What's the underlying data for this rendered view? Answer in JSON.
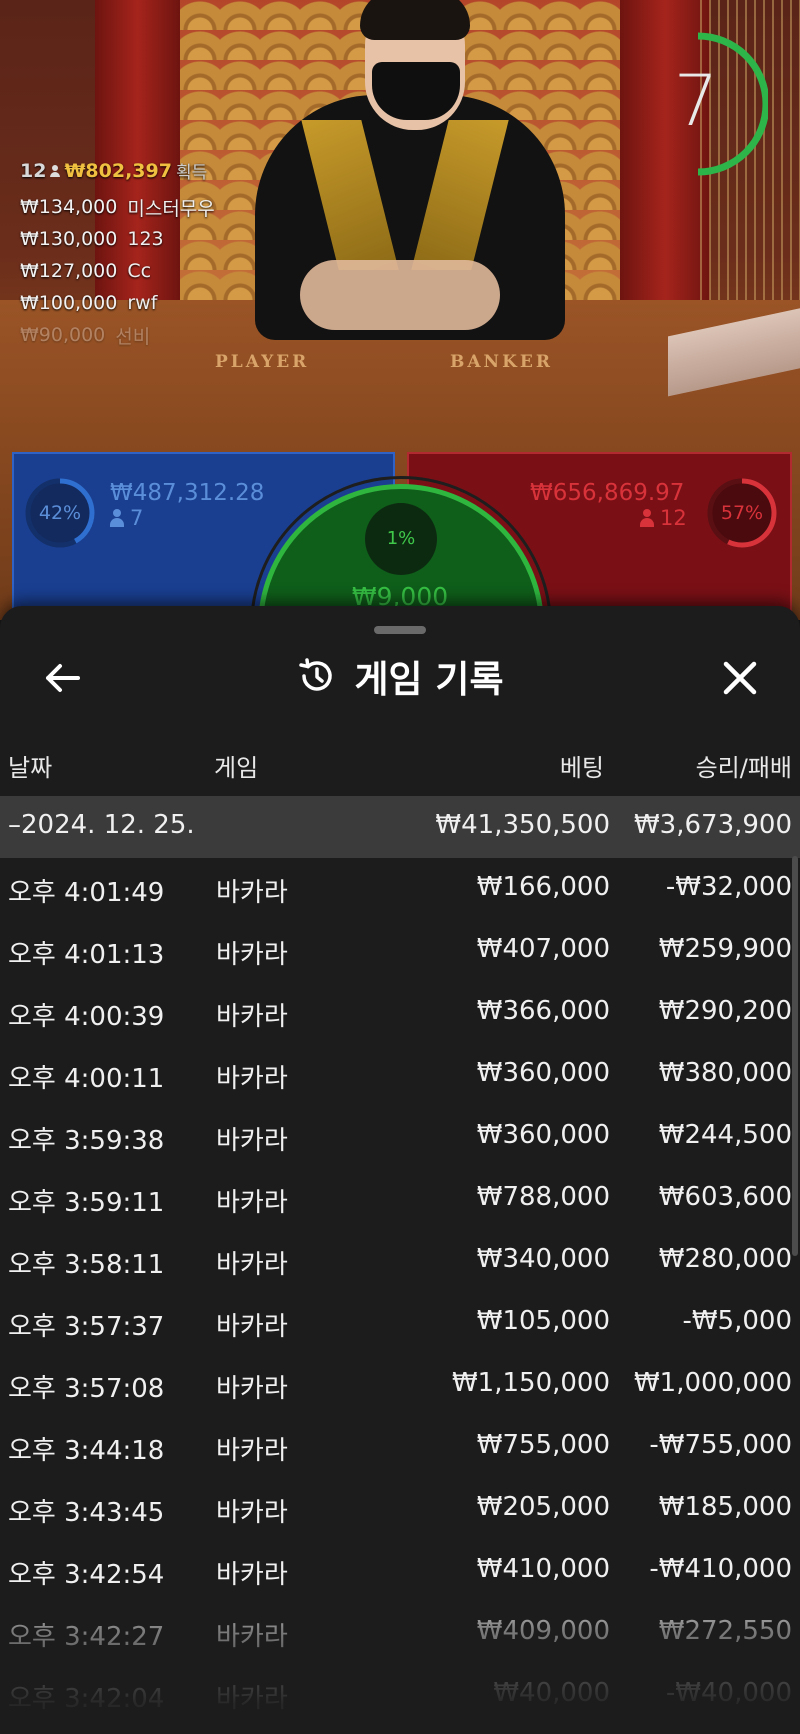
{
  "video": {
    "timer": {
      "value": "7",
      "color": "#2db54a"
    },
    "table_labels": {
      "player": "PLAYER",
      "banker": "BANKER"
    },
    "winners": {
      "count": "12",
      "total": "₩802,397",
      "label": "획득",
      "rows": [
        {
          "amount": "₩134,000",
          "name": "미스터무우"
        },
        {
          "amount": "₩130,000",
          "name": "123"
        },
        {
          "amount": "₩127,000",
          "name": "Cc"
        },
        {
          "amount": "₩100,000",
          "name": "rwf"
        },
        {
          "amount": "₩90,000",
          "name": "선비"
        }
      ]
    }
  },
  "bets": {
    "player": {
      "percent": "42%",
      "percent_value": 42,
      "amount": "₩487,312.28",
      "players": "7",
      "color": "#2f6fd0"
    },
    "banker": {
      "percent": "57%",
      "percent_value": 57,
      "amount": "₩656,869.97",
      "players": "12",
      "color": "#d8323a"
    },
    "tie": {
      "percent": "1%",
      "percent_value": 1,
      "amount": "₩9,000",
      "color": "#2fb63f"
    }
  },
  "sheet": {
    "title": "게임 기록",
    "icons": {
      "back": "arrow-left-icon",
      "history": "history-icon",
      "close": "close-icon"
    },
    "columns": {
      "date": "날짜",
      "game": "게임",
      "bet": "베팅",
      "result": "승리/패배"
    },
    "date_group": {
      "date": "–2024. 12. 25.",
      "bet_total": "₩41,350,500",
      "result_total": "₩3,673,900"
    },
    "rows": [
      {
        "time": "오후 4:01:49",
        "game": "바카라",
        "bet": "₩166,000",
        "result": "-₩32,000"
      },
      {
        "time": "오후 4:01:13",
        "game": "바카라",
        "bet": "₩407,000",
        "result": "₩259,900"
      },
      {
        "time": "오후 4:00:39",
        "game": "바카라",
        "bet": "₩366,000",
        "result": "₩290,200"
      },
      {
        "time": "오후 4:00:11",
        "game": "바카라",
        "bet": "₩360,000",
        "result": "₩380,000"
      },
      {
        "time": "오후 3:59:38",
        "game": "바카라",
        "bet": "₩360,000",
        "result": "₩244,500"
      },
      {
        "time": "오후 3:59:11",
        "game": "바카라",
        "bet": "₩788,000",
        "result": "₩603,600"
      },
      {
        "time": "오후 3:58:11",
        "game": "바카라",
        "bet": "₩340,000",
        "result": "₩280,000"
      },
      {
        "time": "오후 3:57:37",
        "game": "바카라",
        "bet": "₩105,000",
        "result": "-₩5,000"
      },
      {
        "time": "오후 3:57:08",
        "game": "바카라",
        "bet": "₩1,150,000",
        "result": "₩1,000,000"
      },
      {
        "time": "오후 3:44:18",
        "game": "바카라",
        "bet": "₩755,000",
        "result": "-₩755,000"
      },
      {
        "time": "오후 3:43:45",
        "game": "바카라",
        "bet": "₩205,000",
        "result": "₩185,000"
      },
      {
        "time": "오후 3:42:54",
        "game": "바카라",
        "bet": "₩410,000",
        "result": "-₩410,000"
      },
      {
        "time": "오후 3:42:27",
        "game": "바카라",
        "bet": "₩409,000",
        "result": "₩272,550"
      },
      {
        "time": "오후 3:42:04",
        "game": "바카라",
        "bet": "₩40,000",
        "result": "-₩40,000"
      }
    ]
  }
}
